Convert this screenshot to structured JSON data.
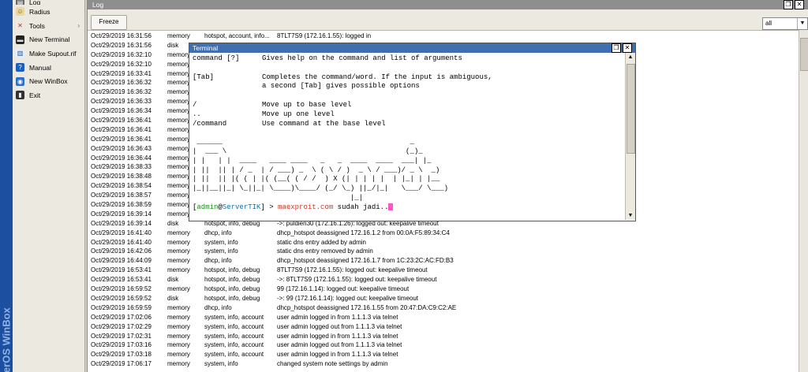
{
  "brand": {
    "text": "terOS WinBox"
  },
  "menu": {
    "items": [
      {
        "label": "Log",
        "icon": "log-icon",
        "has_submenu": false
      },
      {
        "label": "Radius",
        "icon": "radius-icon",
        "has_submenu": false
      },
      {
        "label": "Tools",
        "icon": "tools-icon",
        "has_submenu": true
      },
      {
        "label": "New Terminal",
        "icon": "terminal-icon",
        "has_submenu": false
      },
      {
        "label": "Make Supout.rif",
        "icon": "document-icon",
        "has_submenu": false
      },
      {
        "label": "Manual",
        "icon": "help-icon",
        "has_submenu": false
      },
      {
        "label": "New WinBox",
        "icon": "winbox-icon",
        "has_submenu": false
      },
      {
        "label": "Exit",
        "icon": "exit-icon",
        "has_submenu": false
      }
    ]
  },
  "log": {
    "title": "Log",
    "freeze_label": "Freeze",
    "filter_value": "all",
    "rows": [
      [
        "Oct/29/2019 16:31:56",
        "memory",
        "hotspot, account, info...",
        "8TLT7S9 (172.16.1.55): logged in"
      ],
      [
        "Oct/29/2019 16:31:56",
        "disk",
        "",
        ""
      ],
      [
        "Oct/29/2019 16:32:10",
        "memory",
        "",
        ""
      ],
      [
        "Oct/29/2019 16:32:10",
        "memory",
        "",
        ""
      ],
      [
        "Oct/29/2019 16:33:41",
        "memory",
        "",
        ""
      ],
      [
        "Oct/29/2019 16:36:32",
        "memory",
        "",
        ""
      ],
      [
        "Oct/29/2019 16:36:32",
        "memory",
        "",
        ""
      ],
      [
        "Oct/29/2019 16:36:33",
        "memory",
        "",
        ""
      ],
      [
        "Oct/29/2019 16:36:34",
        "memory",
        "",
        ""
      ],
      [
        "Oct/29/2019 16:36:41",
        "memory",
        "",
        ""
      ],
      [
        "Oct/29/2019 16:36:41",
        "memory",
        "",
        ""
      ],
      [
        "Oct/29/2019 16:36:41",
        "memory",
        "",
        ""
      ],
      [
        "Oct/29/2019 16:36:43",
        "memory",
        "",
        ""
      ],
      [
        "Oct/29/2019 16:36:44",
        "memory",
        "",
        ""
      ],
      [
        "Oct/29/2019 16:38:33",
        "memory",
        "",
        ""
      ],
      [
        "Oct/29/2019 16:38:48",
        "memory",
        "",
        ""
      ],
      [
        "Oct/29/2019 16:38:54",
        "memory",
        "",
        ""
      ],
      [
        "Oct/29/2019 16:38:57",
        "memory",
        "",
        ""
      ],
      [
        "Oct/29/2019 16:38:59",
        "memory",
        "",
        ""
      ],
      [
        "Oct/29/2019 16:39:14",
        "memory",
        "",
        ""
      ],
      [
        "Oct/29/2019 16:39:14",
        "disk",
        "hotspot, info, debug",
        "->: puldien30 (172.16.1.26): logged out: keepalive timeout"
      ],
      [
        "Oct/29/2019 16:41:40",
        "memory",
        "dhcp, info",
        "dhcp_hotspot deassigned 172.16.1.2 from 00:0A:F5:89:34:C4"
      ],
      [
        "Oct/29/2019 16:41:40",
        "memory",
        "system, info",
        "static dns entry added by admin"
      ],
      [
        "Oct/29/2019 16:42:06",
        "memory",
        "system, info",
        "static dns entry removed by admin"
      ],
      [
        "Oct/29/2019 16:44:09",
        "memory",
        "dhcp, info",
        "dhcp_hotspot deassigned 172.16.1.7 from 1C:23:2C:AC:FD:B3"
      ],
      [
        "Oct/29/2019 16:53:41",
        "memory",
        "hotspot, info, debug",
        "8TLT7S9 (172.16.1.55): logged out: keepalive timeout"
      ],
      [
        "Oct/29/2019 16:53:41",
        "disk",
        "hotspot, info, debug",
        "->: 8TLT7S9 (172.16.1.55): logged out: keepalive timeout"
      ],
      [
        "Oct/29/2019 16:59:52",
        "memory",
        "hotspot, info, debug",
        "99 (172.16.1.14): logged out: keepalive timeout"
      ],
      [
        "Oct/29/2019 16:59:52",
        "disk",
        "hotspot, info, debug",
        "->: 99 (172.16.1.14): logged out: keepalive timeout"
      ],
      [
        "Oct/29/2019 16:59:59",
        "memory",
        "dhcp, info",
        "dhcp_hotspot deassigned 172.16.1.55 from 20:47:DA:C9:C2:AE"
      ],
      [
        "Oct/29/2019 17:02:06",
        "memory",
        "system, info, account",
        "user admin logged in from 1.1.1.3 via telnet"
      ],
      [
        "Oct/29/2019 17:02:29",
        "memory",
        "system, info, account",
        "user admin logged out from 1.1.1.3 via telnet"
      ],
      [
        "Oct/29/2019 17:02:31",
        "memory",
        "system, info, account",
        "user admin logged in from 1.1.1.3 via telnet"
      ],
      [
        "Oct/29/2019 17:03:16",
        "memory",
        "system, info, account",
        "user admin logged out from 1.1.1.3 via telnet"
      ],
      [
        "Oct/29/2019 17:03:18",
        "memory",
        "system, info, account",
        "user admin logged in from 1.1.1.3 via telnet"
      ],
      [
        "Oct/29/2019 17:06:17",
        "memory",
        "system, info",
        "changed system note settings by admin"
      ]
    ]
  },
  "terminal": {
    "title": "Terminal",
    "help": [
      {
        "cmd": "command [?]",
        "desc": "Gives help on the command and list of arguments"
      },
      {
        "cmd": "",
        "desc": ""
      },
      {
        "cmd": "[Tab]",
        "desc": "Completes the command/word. If the input is ambiguous,"
      },
      {
        "cmd": "",
        "desc": "a second [Tab] gives possible options"
      },
      {
        "cmd": "",
        "desc": ""
      },
      {
        "cmd": "/",
        "desc": "Move up to base level"
      },
      {
        "cmd": "..",
        "desc": "Move up one level"
      },
      {
        "cmd": "/command",
        "desc": "Use command at the base level"
      }
    ],
    "banner": [
      " ______                                            _      ",
      "|  ___ \\                                          (_)_    ",
      "| |   | |  ____   ____ ____   _   _  ____  ____  ___| |_  ",
      "| ||  || | / _  | / ___) _  \\ ( \\ / )  _ \\ / ___)/ _ \\  _) ",
      "| ||  || |( ( | |( (__( ( / /  ) X (| | | | |  | |_| | |__ ",
      "|_||__||_| \\_||_| \\____)\\____/ (_/ \\_) ||_/|_|   \\___/ \\___)",
      "                                     |_|                  "
    ],
    "prompt": {
      "open": "[",
      "user": "admin",
      "at": "@",
      "host": "ServerTIK",
      "close": "] > ",
      "typed_domain": "maexproit.com",
      "typed_rest": " sudah jadi.."
    }
  }
}
